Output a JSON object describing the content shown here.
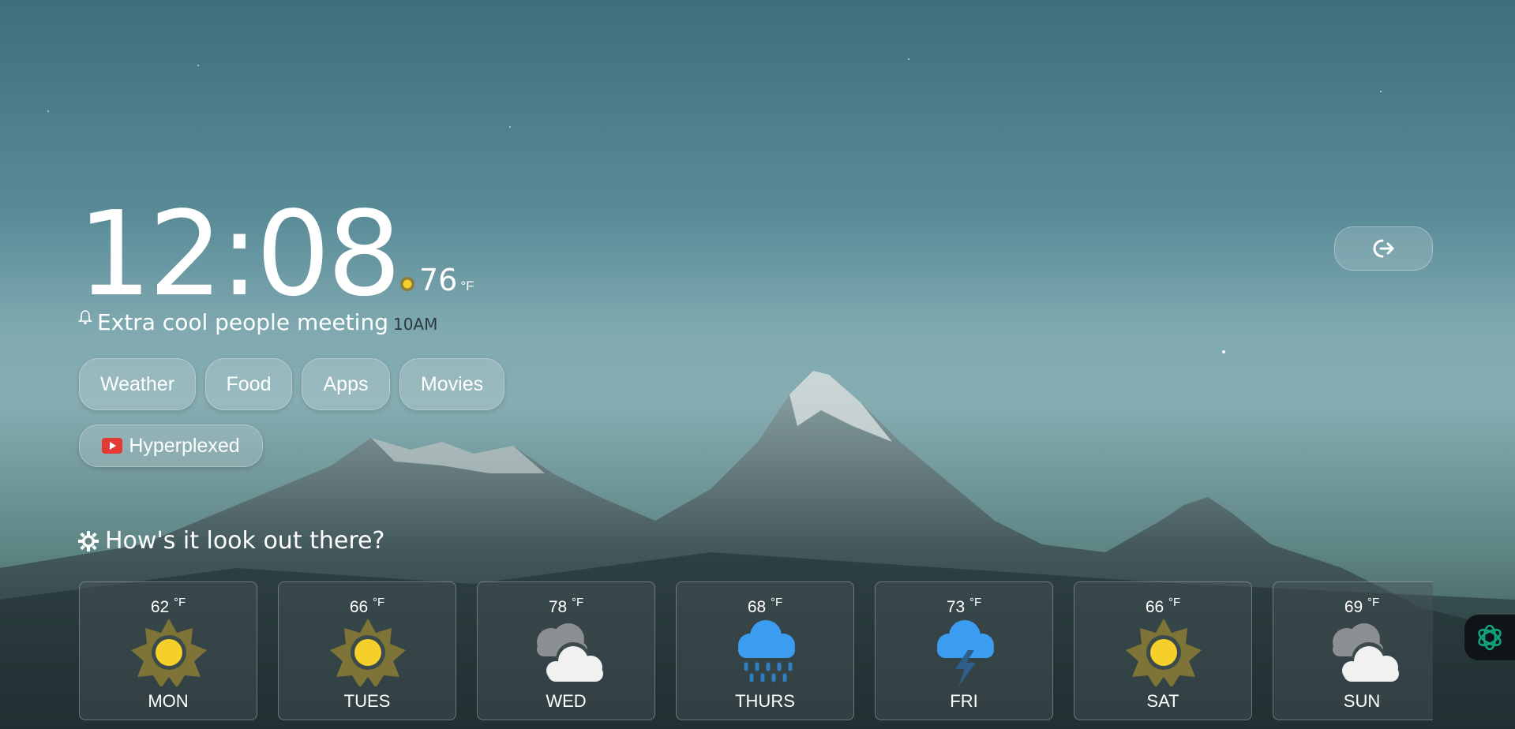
{
  "clock": {
    "time": "12:08"
  },
  "current_weather": {
    "icon": "sun-icon",
    "temp": "76",
    "unit": "°F"
  },
  "reminder": {
    "icon": "bell-icon",
    "title": "Extra cool people meeting",
    "time": "10AM"
  },
  "links": [
    {
      "label": "Weather"
    },
    {
      "label": "Food"
    },
    {
      "label": "Apps"
    },
    {
      "label": "Movies"
    },
    {
      "label": "Hyperplexed",
      "icon": "youtube-icon"
    }
  ],
  "logout": {
    "icon": "logout-icon"
  },
  "forecast": {
    "icon": "sun-gear-icon",
    "title": "How's it look out there?",
    "unit": "°F",
    "days": [
      {
        "temp": "62",
        "day": "MON",
        "icon": "sunny-icon"
      },
      {
        "temp": "66",
        "day": "TUES",
        "icon": "sunny-icon"
      },
      {
        "temp": "78",
        "day": "WED",
        "icon": "cloudy-icon"
      },
      {
        "temp": "68",
        "day": "THURS",
        "icon": "rain-icon"
      },
      {
        "temp": "73",
        "day": "FRI",
        "icon": "thunderstorm-icon"
      },
      {
        "temp": "66",
        "day": "SAT",
        "icon": "sunny-icon"
      },
      {
        "temp": "69",
        "day": "SUN",
        "icon": "cloudy-icon"
      }
    ]
  },
  "colors": {
    "accent_sun": "#f5d02a",
    "sun_rays": "#7f7438",
    "rain_cloud": "#3b9cf0",
    "assistant": "#10a37f"
  }
}
